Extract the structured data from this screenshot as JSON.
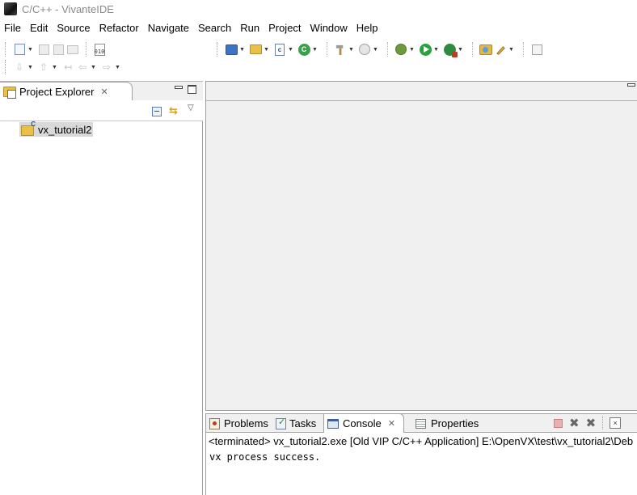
{
  "window": {
    "title": "C/C++ - VivanteIDE"
  },
  "menu": [
    "File",
    "Edit",
    "Source",
    "Refactor",
    "Navigate",
    "Search",
    "Run",
    "Project",
    "Window",
    "Help"
  ],
  "project_explorer": {
    "tab_label": "Project Explorer",
    "tree": [
      {
        "label": "vx_tutorial2"
      }
    ]
  },
  "bottom_panel": {
    "tabs": {
      "problems": "Problems",
      "tasks": "Tasks",
      "console": "Console",
      "properties": "Properties"
    },
    "active_tab": "Console",
    "console_header": "<terminated> vx_tutorial2.exe [Old VIP C/C++ Application] E:\\OpenVX\\test\\vx_tutorial2\\Deb",
    "console_output": "vx process success."
  },
  "colors": {
    "title_text": "#8a8a8a",
    "selection": "#d9d9d9",
    "panel_bg": "#f0f0f0",
    "border": "#9f9f9f"
  }
}
